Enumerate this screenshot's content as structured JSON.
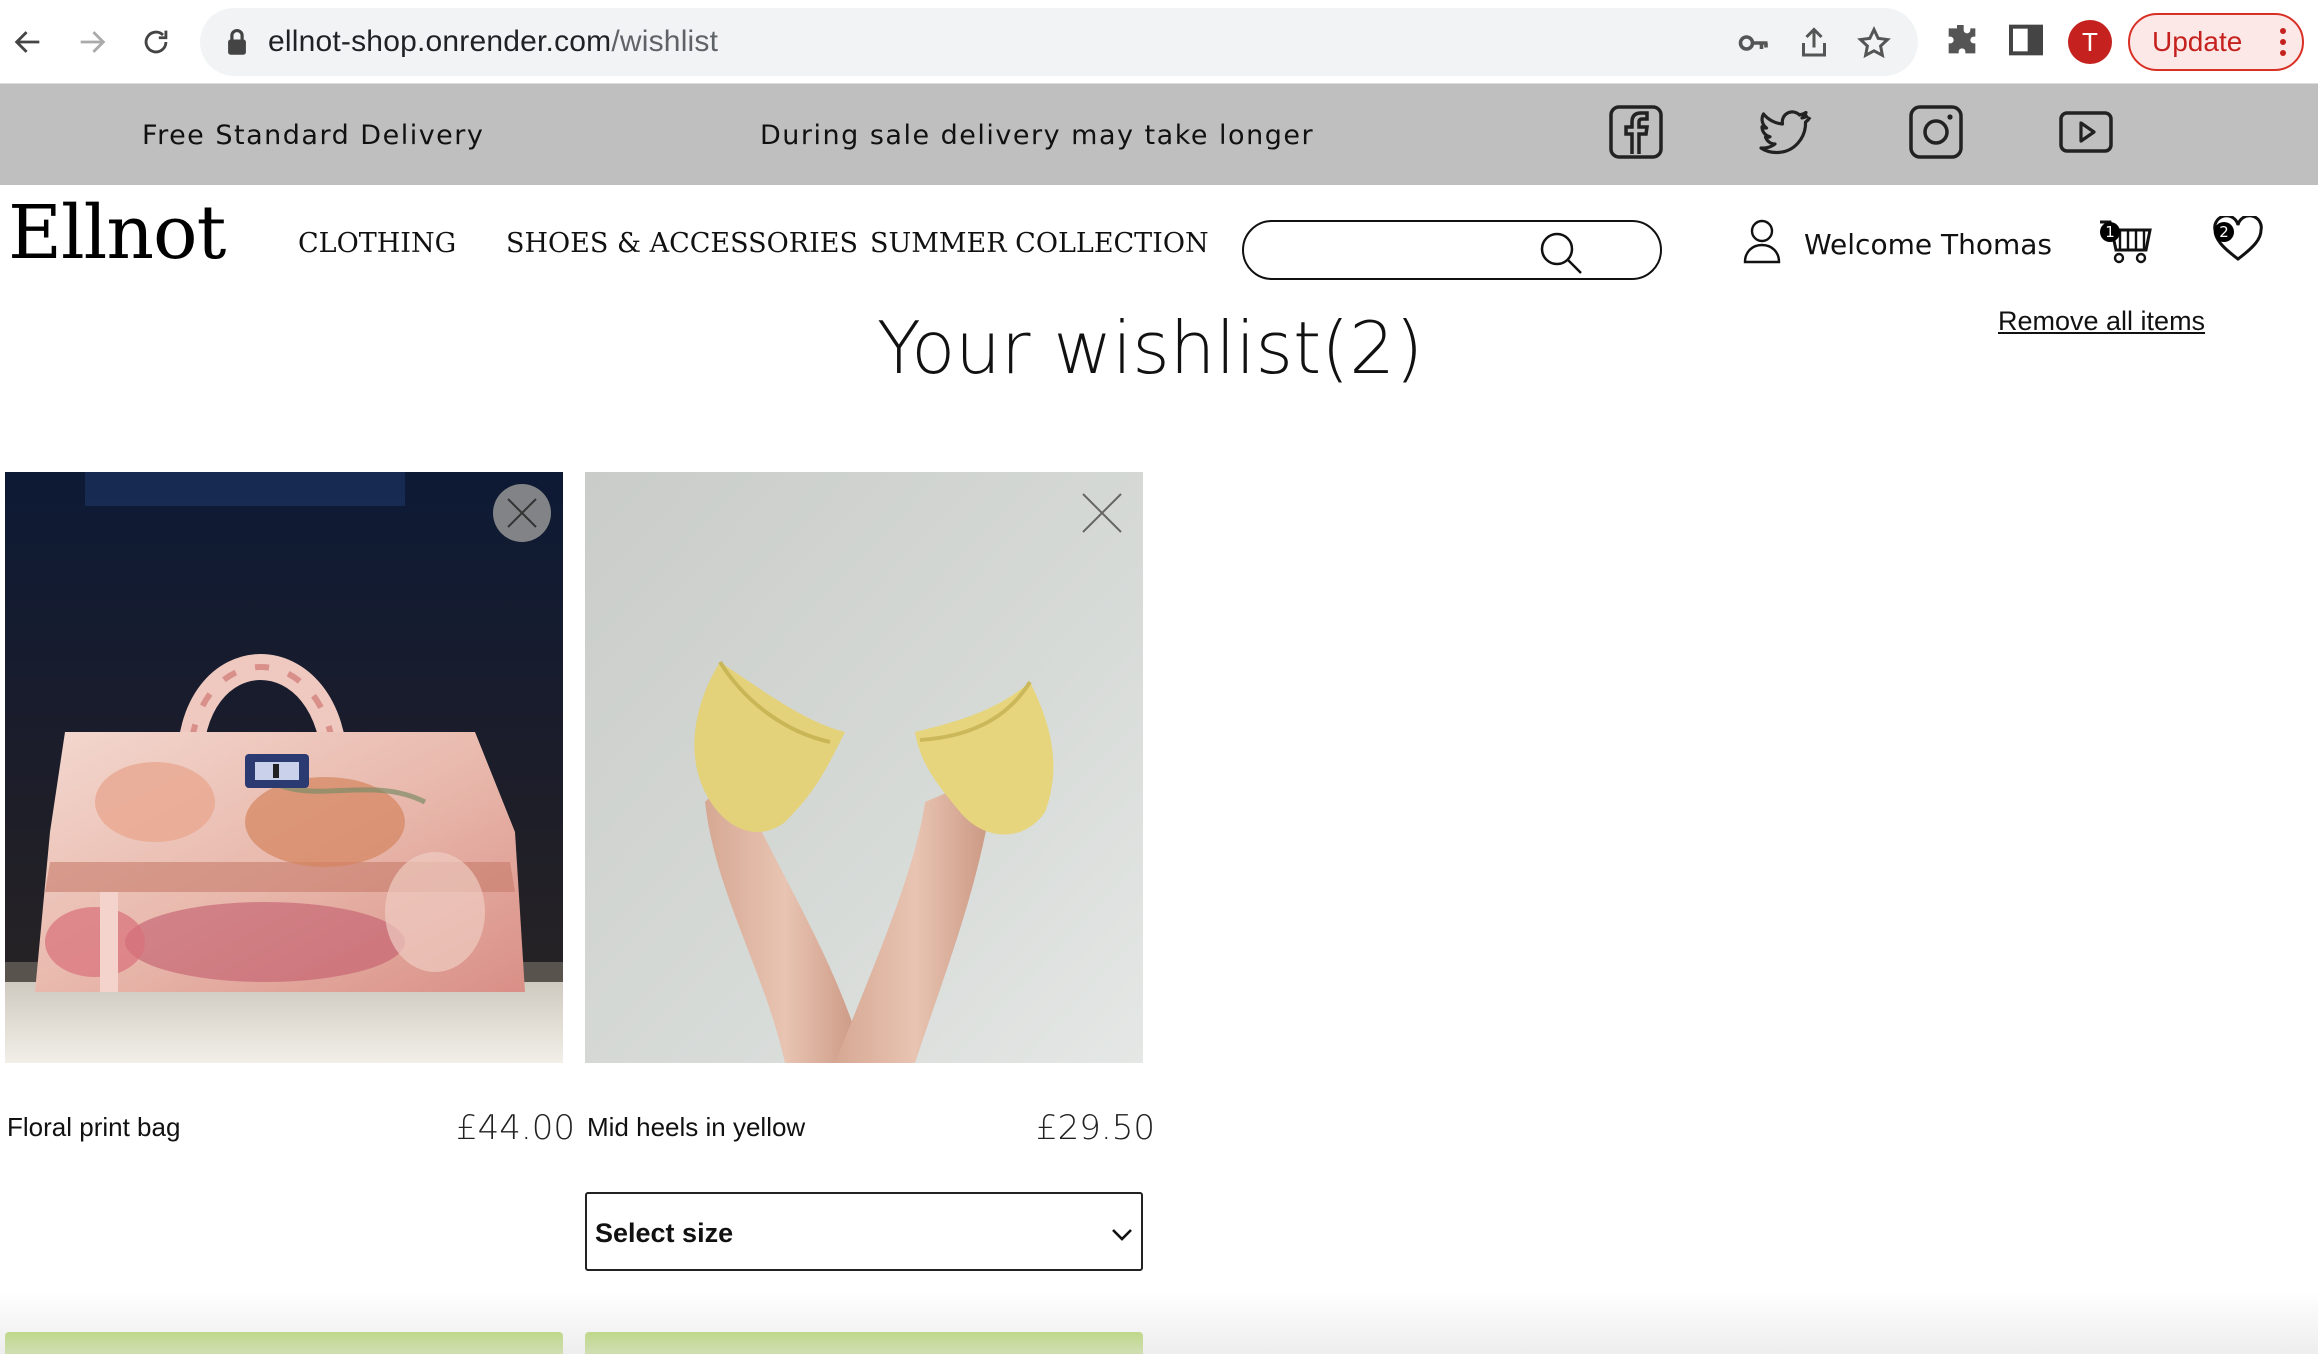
{
  "browser": {
    "url_host": "ellnot-shop.onrender.com",
    "url_path": "/wishlist",
    "profile_initial": "T",
    "update_label": "Update",
    "icons": [
      "back-icon",
      "forward-icon",
      "reload-icon",
      "lock-icon",
      "key-icon",
      "share-icon",
      "star-icon",
      "extensions-icon",
      "side-panel-icon",
      "more-icon"
    ]
  },
  "promo": {
    "left_text": "Free Standard Delivery",
    "center_text": "During sale delivery may take longer",
    "social": [
      "facebook-icon",
      "twitter-icon",
      "instagram-icon",
      "youtube-icon"
    ]
  },
  "header": {
    "logo": "Ellnot",
    "nav": [
      "CLOTHING",
      "SHOES & ACCESSORIES",
      "SUMMER COLLECTION"
    ],
    "search_placeholder": "",
    "welcome": "Welcome Thomas",
    "cart_count": "1",
    "wishlist_count": "2"
  },
  "page": {
    "title": "Your wishlist(2)",
    "remove_all": "Remove all items"
  },
  "items": [
    {
      "name": "Floral print bag",
      "price": "£44.00"
    },
    {
      "name": "Mid heels in yellow",
      "price": "£29.50",
      "size_select": "Select size"
    }
  ],
  "colors": {
    "promo_bg": "#bfbfbf",
    "add_to_bag": "#9ccc3c",
    "update_red": "#c5221f"
  }
}
